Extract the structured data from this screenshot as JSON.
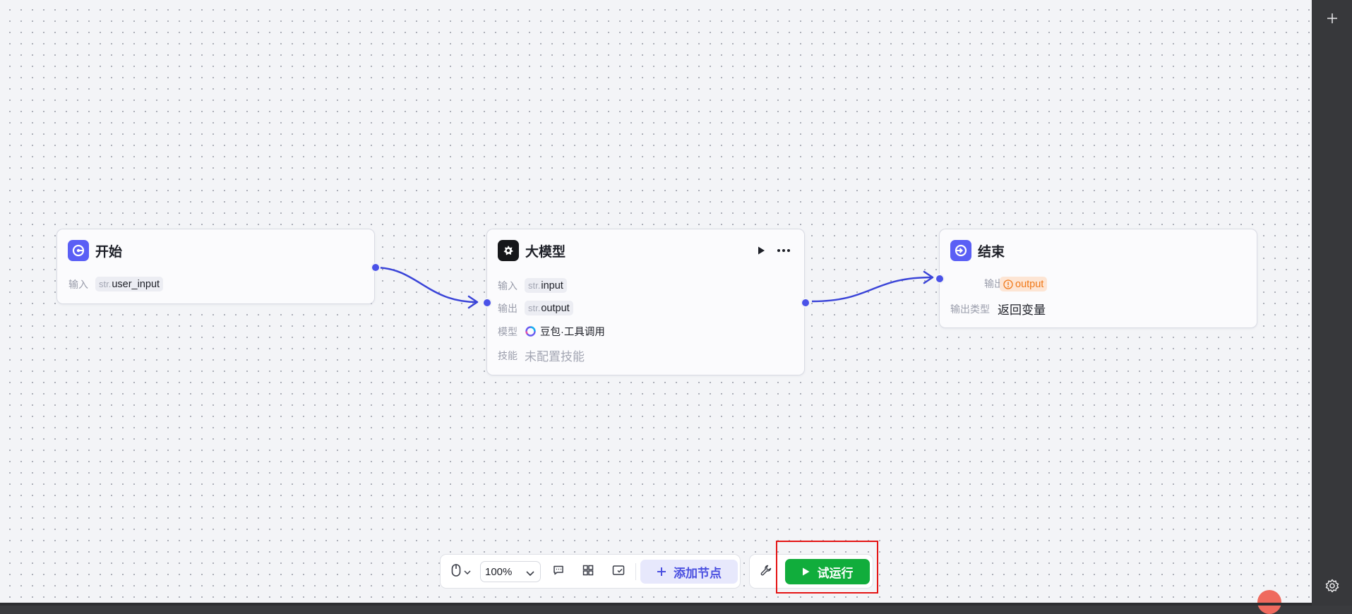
{
  "nodes": {
    "start": {
      "title": "开始",
      "rows": [
        {
          "label": "输入",
          "prefix": "str.",
          "value": "user_input"
        }
      ]
    },
    "llm": {
      "title": "大模型",
      "rows": [
        {
          "label": "输入",
          "prefix": "str.",
          "value": "input"
        },
        {
          "label": "输出",
          "prefix": "str.",
          "value": "output"
        }
      ],
      "model_label": "模型",
      "model_value": "豆包·工具调用",
      "skill_label": "技能",
      "skill_value": "未配置技能"
    },
    "end": {
      "title": "结束",
      "output_label": "输出",
      "output_value": "output",
      "output_type_label": "输出类型",
      "output_type_value": "返回变量"
    }
  },
  "toolbar": {
    "zoom": "100%",
    "add_node_label": "添加节点",
    "run_label": "试运行"
  },
  "colors": {
    "accent": "#4a52e8",
    "run_green": "#11ad3c",
    "warn_orange": "#f07818",
    "highlight_red": "#e51414"
  },
  "icons": [
    "start-node-icon",
    "llm-node-icon",
    "end-node-icon",
    "play-icon",
    "more-icon",
    "mouse-icon",
    "chevron-down-icon",
    "comment-icon",
    "grid-icon",
    "minimap-icon",
    "plus-icon",
    "wrench-icon",
    "settings-icon",
    "warning-icon",
    "doubao-model-icon"
  ]
}
